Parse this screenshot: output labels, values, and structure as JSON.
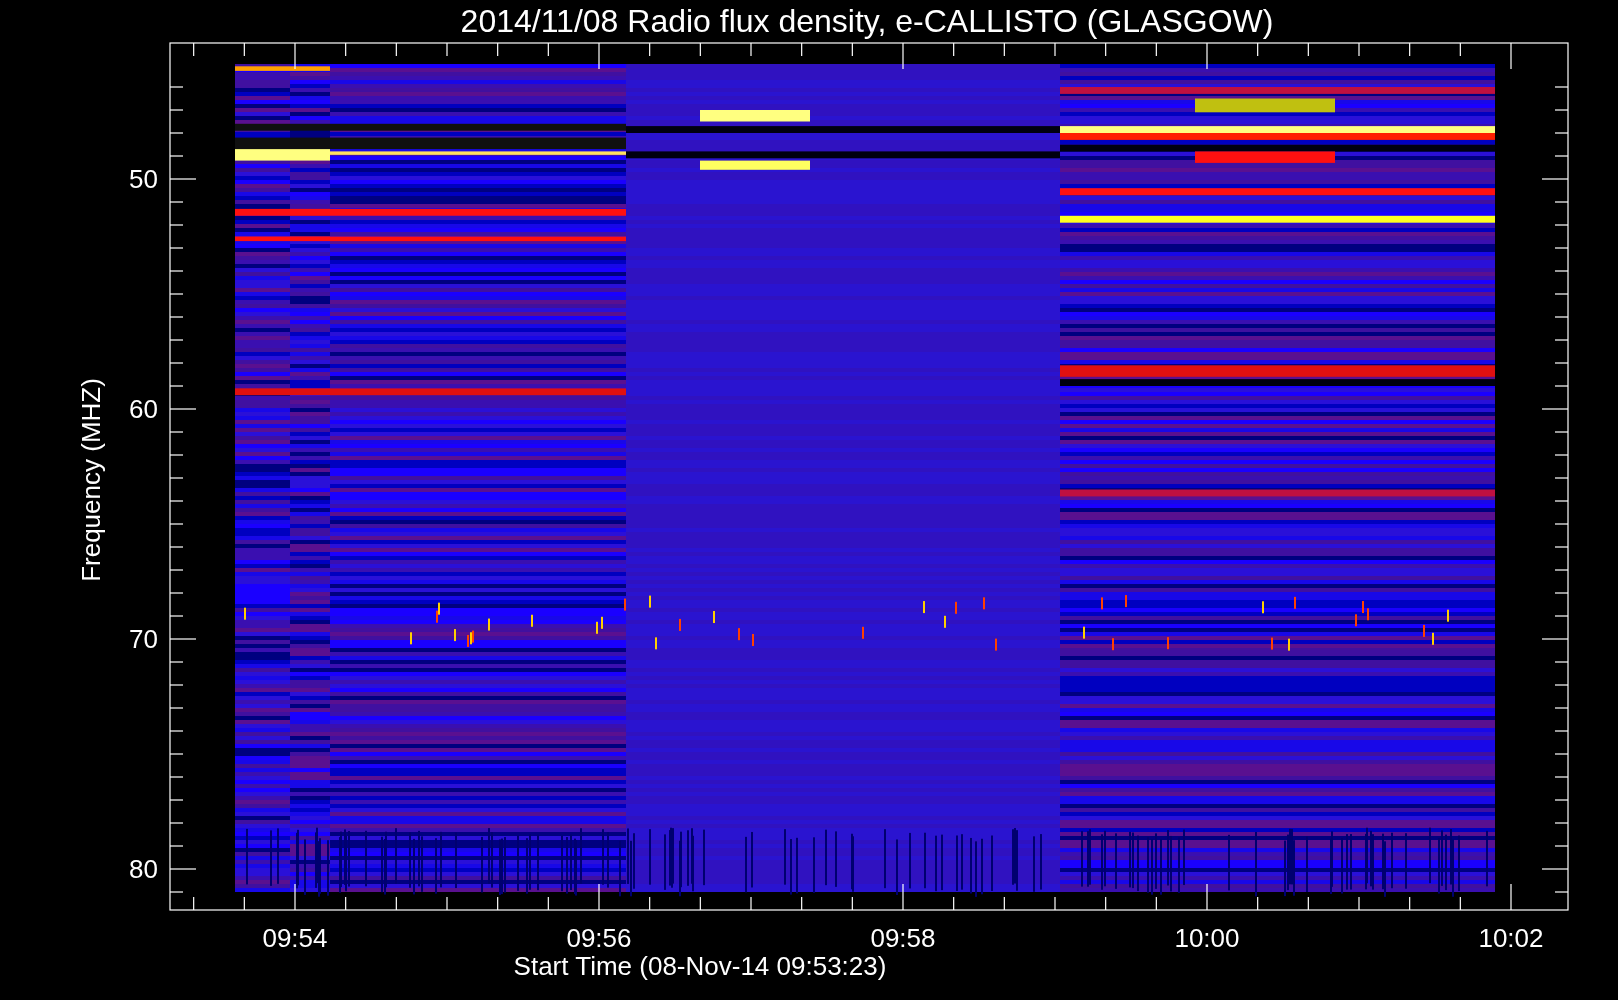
{
  "title": "2014/11/08  Radio flux density, e-CALLISTO (GLASGOW)",
  "y_axis": {
    "label": "Frequency (MHZ)",
    "ticks": [
      "50",
      "60",
      "70",
      "80"
    ]
  },
  "x_axis": {
    "label": "Start Time (08-Nov-14 09:53:23)",
    "ticks": [
      "09:54",
      "09:56",
      "09:58",
      "10:00",
      "10:02"
    ]
  }
}
